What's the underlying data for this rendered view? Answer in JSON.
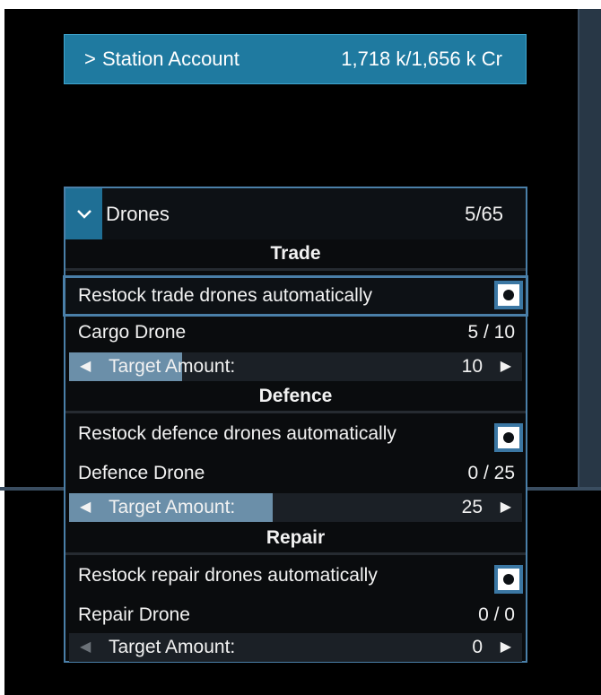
{
  "station_account": {
    "label": "Station Account",
    "value": "1,718 k/1,656 k Cr",
    "chevron": ">"
  },
  "drones": {
    "label": "Drones",
    "count": "5/65",
    "chevron": "⌄",
    "sections": {
      "trade": {
        "heading": "Trade",
        "restock_label": "Restock trade drones automatically",
        "restock_enabled": true,
        "drone_name": "Cargo Drone",
        "drone_count": "5 / 10",
        "target_label": "Target Amount:",
        "target_value": "10",
        "target_fraction": 0.25
      },
      "defence": {
        "heading": "Defence",
        "restock_label": "Restock defence drones automatically",
        "restock_enabled": true,
        "drone_name": "Defence Drone",
        "drone_count": "0 / 25",
        "target_label": "Target Amount:",
        "target_value": "25",
        "target_fraction": 0.45
      },
      "repair": {
        "heading": "Repair",
        "restock_label": "Restock repair drones automatically",
        "restock_enabled": true,
        "drone_name": "Repair Drone",
        "drone_count": "0 / 0",
        "target_label": "Target Amount:",
        "target_value": "0",
        "target_fraction": 0
      }
    }
  },
  "icons": {
    "arrow_left": "◀",
    "arrow_right": "▶"
  },
  "colors": {
    "accent": "#1f7aa0",
    "panel_border": "#4a7fa8",
    "slider_fill": "#6b8fa9"
  }
}
